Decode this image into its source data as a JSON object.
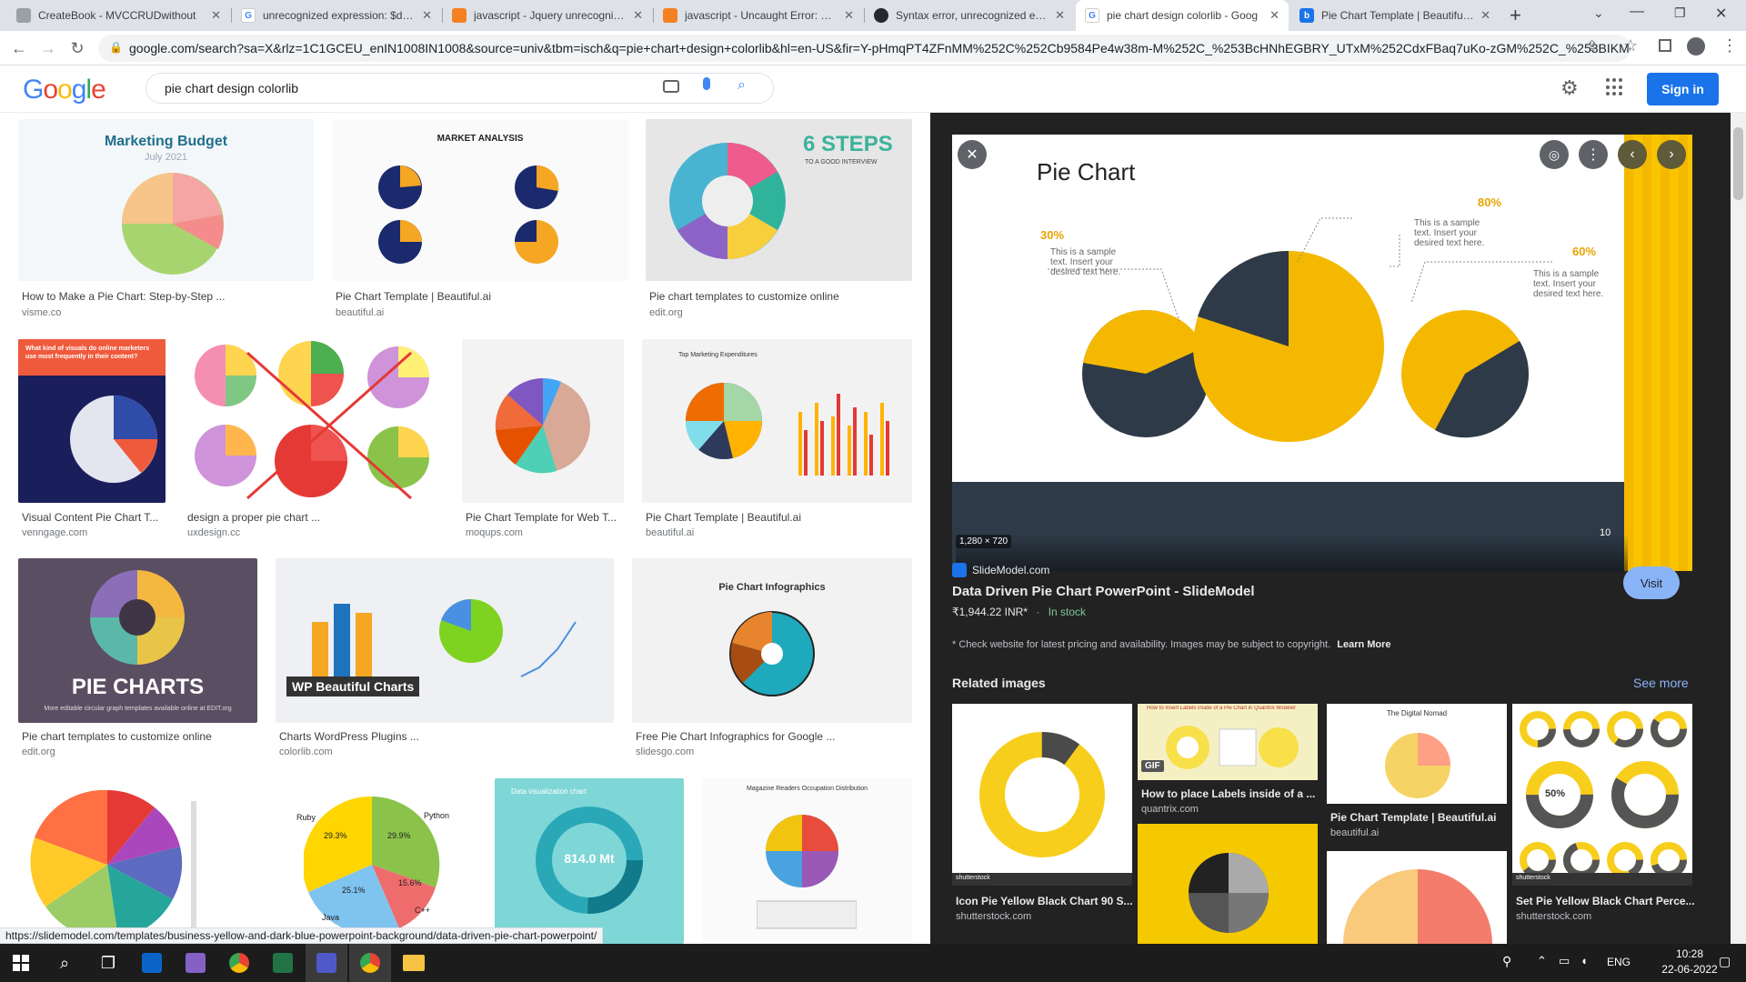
{
  "tabs": [
    {
      "title": "CreateBook - MVCCRUDwithout",
      "favicon": "page",
      "active": false
    },
    {
      "title": "unrecognized expression: $ddlst",
      "favicon": "google",
      "active": false
    },
    {
      "title": "javascript - Jquery unrecognized",
      "favicon": "stackoverflow",
      "active": false
    },
    {
      "title": "javascript - Uncaught Error: Synt",
      "favicon": "stackoverflow",
      "active": false
    },
    {
      "title": "Syntax error, unrecognized expr",
      "favicon": "github",
      "active": false
    },
    {
      "title": "pie chart design colorlib - Goog",
      "favicon": "google",
      "active": true
    },
    {
      "title": "Pie Chart Template | Beautiful.ai",
      "favicon": "beautifulai",
      "active": false
    }
  ],
  "address_bar": {
    "url": "google.com/search?sa=X&rlz=1C1GCEU_enIN1008IN1008&source=univ&tbm=isch&q=pie+chart+design+colorlib&hl=en-US&fir=Y-pHmqPT4ZFnMM%252C%252Cb9584Pe4w38m-M%252C_%253BcHNhEGBRY_UTxM%252CdxFBaq7uKo-zGM%252C_%253BIKMg..."
  },
  "google": {
    "logo_text": "Google",
    "search_query": "pie chart design colorlib",
    "signin_label": "Sign in"
  },
  "results": [
    {
      "caption": "How to Make a Pie Chart: Step-by-Step ...",
      "source": "visme.co",
      "thumb_title": "Marketing Budget",
      "thumb_sub": "July 2021"
    },
    {
      "caption": "Pie Chart Template | Beautiful.ai",
      "source": "beautiful.ai",
      "thumb_title": "MARKET ANALYSIS"
    },
    {
      "caption": "Pie chart templates to customize online",
      "source": "edit.org",
      "thumb_title": "6 STEPS",
      "thumb_sub": "TO A GOOD INTERVIEW"
    },
    {
      "caption": "Visual Content Pie Chart T...",
      "source": "venngage.com",
      "thumb_title": "What kind of visuals do online marketers use most frequently in their content?"
    },
    {
      "caption": "design a proper pie chart ...",
      "source": "uxdesign.cc"
    },
    {
      "caption": "Pie Chart Template for Web T...",
      "source": "moqups.com"
    },
    {
      "caption": "Pie Chart Template | Beautiful.ai",
      "source": "beautiful.ai",
      "thumb_title": "Top Marketing Expenditures"
    },
    {
      "caption": "Pie chart templates to customize online",
      "source": "edit.org",
      "thumb_title": "PIE CHARTS",
      "thumb_sub": "More editable circular graph templates available online at EDIT.org"
    },
    {
      "caption": "Charts WordPress Plugins ...",
      "source": "colorlib.com",
      "thumb_title": "WP Beautiful Charts"
    },
    {
      "caption": "Free Pie Chart Infographics for Google ...",
      "source": "slidesgo.com",
      "thumb_title": "Pie Chart Infographics"
    },
    {
      "caption": "",
      "source": ""
    },
    {
      "caption": "",
      "source": "",
      "thumb_labels": [
        "Ruby",
        "Python",
        "Java",
        "C++",
        "29.3%",
        "29.9%",
        "25.1%",
        "15.6%"
      ]
    },
    {
      "caption": "",
      "source": "",
      "thumb_title": "Data visualization chart",
      "thumb_sub": "814.0 Mt"
    },
    {
      "caption": "",
      "source": "",
      "thumb_title": "Magazine Readers Occupation Distribution"
    }
  ],
  "preview": {
    "slide_title": "Pie Chart",
    "labels": [
      {
        "pct": "30%",
        "text": "This is a sample text. Insert your desired text here."
      },
      {
        "pct": "80%",
        "text": "This is a sample text. Insert your desired text here."
      },
      {
        "pct": "60%",
        "text": "This is a sample text. Insert your desired text here."
      }
    ],
    "dimensions": "1,280 × 720",
    "slide_number": "10",
    "site": "SlideModel.com",
    "title": "Data Driven Pie Chart PowerPoint - SlideModel",
    "price": "₹1,944.22 INR*",
    "separator": "·",
    "stock": "In stock",
    "visit_label": "Visit",
    "disclaimer": "* Check website for latest pricing and availability. Images may be subject to copyright.",
    "learn_more": "Learn More",
    "related_heading": "Related images",
    "see_more": "See more",
    "related": [
      {
        "caption": "Icon Pie Yellow Black Chart 90 S...",
        "source": "shutterstock.com",
        "badge": "90%",
        "mark": "shutterstock"
      },
      {
        "caption": "How to place Labels inside of a ...",
        "source": "quantrix.com",
        "gif": "GIF",
        "thumb_title": "How to insert Labels inside of a Pie Chart in Quantrix Modeler"
      },
      {
        "caption": "Pie Chart Template | Beautiful.ai",
        "source": "beautiful.ai",
        "thumb_title": "The Digital Nomad"
      },
      {
        "caption": "Set Pie Yellow Black Chart Perce...",
        "source": "shutterstock.com",
        "badge": "50%",
        "mark": "shutterstock"
      }
    ]
  },
  "status_url": "https://slidemodel.com/templates/business-yellow-and-dark-blue-powerpoint-background/data-driven-pie-chart-powerpoint/",
  "taskbar": {
    "lang": "ENG",
    "time": "10:28",
    "date": "22-06-2022"
  },
  "colors": {
    "accent": "#1a73e8",
    "yellow": "#f5b800",
    "navy": "#2e3a47",
    "panel": "#222222"
  }
}
